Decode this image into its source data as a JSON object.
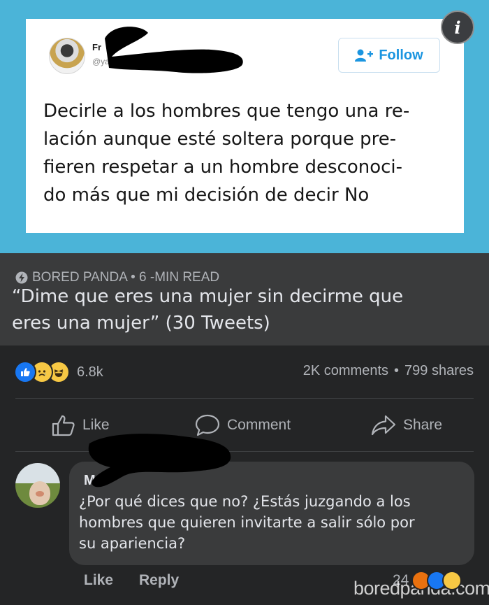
{
  "tweet": {
    "author_name_visible": "Fr",
    "author_handle_visible": "@ya",
    "follow_label": "Follow",
    "info_glyph": "i",
    "text_lines": [
      "Decirle a los hombres que tengo una re-",
      "lación aunque esté soltera porque pre-",
      "fieren respetar a un hombre desconoci-",
      "do más que mi decisión de decir No"
    ]
  },
  "link_preview": {
    "source": "BORED PANDA • 6 -MIN READ",
    "title_lines": [
      "“Dime que eres una mujer sin decirme que",
      "eres una mujer” (30 Tweets)"
    ]
  },
  "post_stats": {
    "reaction_icons": [
      "like-reaction",
      "sad-reaction",
      "haha-reaction"
    ],
    "reaction_count": "6.8k",
    "comments": "2K comments",
    "separator": "•",
    "shares": "799 shares"
  },
  "actions": {
    "like": "Like",
    "comment": "Comment",
    "share": "Share"
  },
  "comment": {
    "author_visible": "M",
    "text_lines": [
      "¿Por qué dices que no? ¿Estás juzgando a los",
      "hombres que quieren invitarte a salir sólo por",
      "su apariencia?"
    ],
    "like_label": "Like",
    "reply_label": "Reply",
    "reaction_count": "24",
    "reaction_icons": [
      "angry-reaction",
      "like-reaction",
      "haha-reaction"
    ]
  },
  "watermark": "boredpanda.com",
  "colors": {
    "tweet_background": "#4bb4d8",
    "twitter_blue": "#1b95e0",
    "facebook_blue": "#1877f2",
    "dark_surface": "#242526",
    "preview_surface": "#3a3b3c"
  }
}
